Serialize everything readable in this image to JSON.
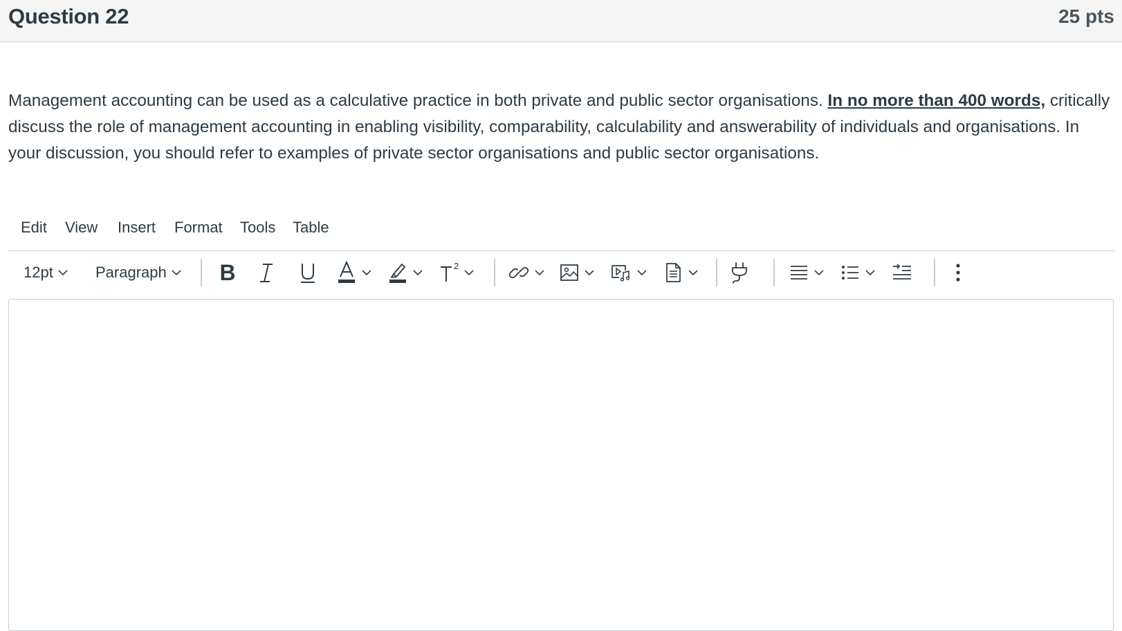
{
  "question": {
    "title": "Question 22",
    "points": "25 pts",
    "text_part1": "Management accounting can be used as a calculative practice in both private and public sector organisations. ",
    "text_emphasis": "In no more than 400 words,",
    "text_part2": " critically discuss the role of management accounting in enabling visibility, comparability, calculability and answerability of individuals and organisations. In your discussion, you should refer to examples of private sector organisations and public sector organisations."
  },
  "editor": {
    "menu": [
      "Edit",
      "View",
      "Insert",
      "Format",
      "Tools",
      "Table"
    ],
    "font_size": "12pt",
    "block_format": "Paragraph",
    "content": ""
  },
  "colors": {
    "header_bg": "#f5f5f5",
    "text": "#2d3b45",
    "border": "#c7cdd1",
    "icon": "#2d3b45"
  },
  "icons": [
    "bold-icon",
    "italic-icon",
    "underline-icon",
    "text-color-icon",
    "highlight-icon",
    "superscript-icon",
    "link-icon",
    "image-icon",
    "media-icon",
    "document-icon",
    "plugin-icon",
    "align-icon",
    "bullet-list-icon",
    "indent-icon",
    "more-options-icon"
  ]
}
